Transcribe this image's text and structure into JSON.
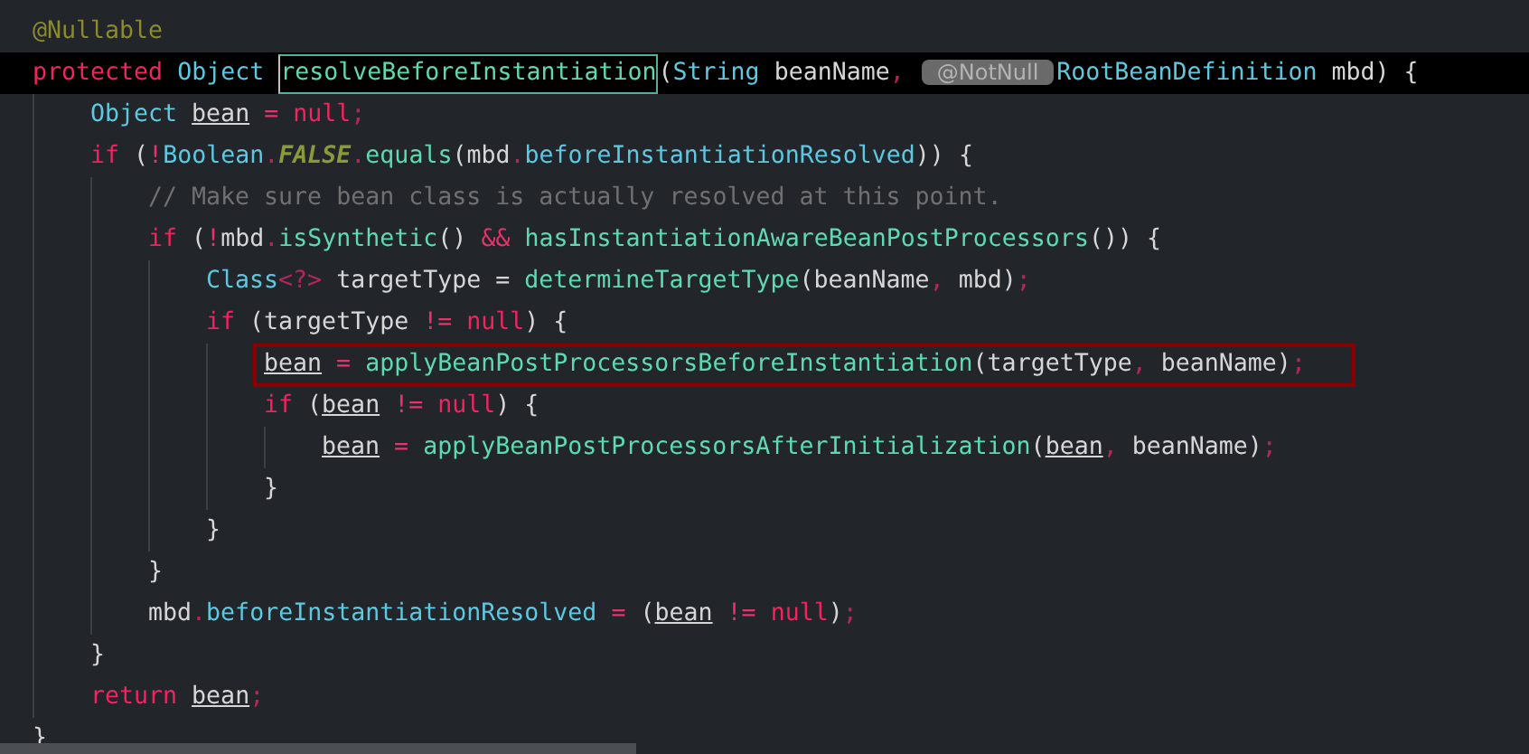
{
  "editor": {
    "lines": [
      {
        "tokens": [
          {
            "text": "@Nullable",
            "kind": "annotation"
          }
        ]
      },
      {
        "current": true,
        "tokens": [
          {
            "text": "protected ",
            "kind": "keyword"
          },
          {
            "text": "Object ",
            "kind": "type"
          },
          {
            "text": "resolveBeforeInstantiation",
            "kind": "method",
            "outlined": true
          },
          {
            "text": "(",
            "kind": "plain"
          },
          {
            "text": "String ",
            "kind": "type"
          },
          {
            "text": "beanName",
            "kind": "plain"
          },
          {
            "text": ",",
            "kind": "punct"
          },
          {
            "text": "@NotNull",
            "kind": "hint"
          },
          {
            "text": "RootBeanDefinition ",
            "kind": "type"
          },
          {
            "text": "mbd) {",
            "kind": "plain"
          }
        ],
        "children": [
          {
            "tokens": [
              {
                "text": "Object ",
                "kind": "type"
              },
              {
                "text": "bean",
                "kind": "variable"
              },
              {
                "text": " = ",
                "kind": "operator"
              },
              {
                "text": "null",
                "kind": "keyword"
              },
              {
                "text": ";",
                "kind": "punct"
              }
            ]
          },
          {
            "tokens": [
              {
                "text": "if ",
                "kind": "keyword"
              },
              {
                "text": "(",
                "kind": "plain"
              },
              {
                "text": "!",
                "kind": "operator"
              },
              {
                "text": "Boolean",
                "kind": "type"
              },
              {
                "text": ".",
                "kind": "punct"
              },
              {
                "text": "FALSE",
                "kind": "constant"
              },
              {
                "text": ".",
                "kind": "punct"
              },
              {
                "text": "equals",
                "kind": "method"
              },
              {
                "text": "(mbd",
                "kind": "plain"
              },
              {
                "text": ".",
                "kind": "punct"
              },
              {
                "text": "beforeInstantiationResolved",
                "kind": "field"
              },
              {
                "text": ")) {",
                "kind": "plain"
              }
            ],
            "children": [
              {
                "tokens": [
                  {
                    "text": "// Make sure bean class is actually resolved at this point.",
                    "kind": "comment"
                  }
                ]
              },
              {
                "tokens": [
                  {
                    "text": "if ",
                    "kind": "keyword"
                  },
                  {
                    "text": "(",
                    "kind": "plain"
                  },
                  {
                    "text": "!",
                    "kind": "operator"
                  },
                  {
                    "text": "mbd",
                    "kind": "plain"
                  },
                  {
                    "text": ".",
                    "kind": "punct"
                  },
                  {
                    "text": "isSynthetic",
                    "kind": "method"
                  },
                  {
                    "text": "() ",
                    "kind": "plain"
                  },
                  {
                    "text": "&& ",
                    "kind": "operator"
                  },
                  {
                    "text": "hasInstantiationAwareBeanPostProcessors",
                    "kind": "method"
                  },
                  {
                    "text": "()) {",
                    "kind": "plain"
                  }
                ],
                "children": [
                  {
                    "tokens": [
                      {
                        "text": "Class",
                        "kind": "type"
                      },
                      {
                        "text": "<?>",
                        "kind": "punct"
                      },
                      {
                        "text": " targetType = ",
                        "kind": "plain"
                      },
                      {
                        "text": "determineTargetType",
                        "kind": "method"
                      },
                      {
                        "text": "(beanName",
                        "kind": "plain"
                      },
                      {
                        "text": ",",
                        "kind": "punct"
                      },
                      {
                        "text": " mbd)",
                        "kind": "plain"
                      },
                      {
                        "text": ";",
                        "kind": "punct"
                      }
                    ]
                  },
                  {
                    "tokens": [
                      {
                        "text": "if ",
                        "kind": "keyword"
                      },
                      {
                        "text": "(targetType ",
                        "kind": "plain"
                      },
                      {
                        "text": "!= ",
                        "kind": "operator"
                      },
                      {
                        "text": "null",
                        "kind": "keyword"
                      },
                      {
                        "text": ") {",
                        "kind": "plain"
                      }
                    ],
                    "children": [
                      {
                        "boxed": true,
                        "tokens": [
                          {
                            "text": "bean",
                            "kind": "variable"
                          },
                          {
                            "text": " = ",
                            "kind": "operator"
                          },
                          {
                            "text": "applyBeanPostProcessorsBeforeInstantiation",
                            "kind": "method"
                          },
                          {
                            "text": "(targetType",
                            "kind": "plain"
                          },
                          {
                            "text": ",",
                            "kind": "punct"
                          },
                          {
                            "text": " beanName)",
                            "kind": "plain"
                          },
                          {
                            "text": ";",
                            "kind": "punct"
                          }
                        ]
                      },
                      {
                        "tokens": [
                          {
                            "text": "if ",
                            "kind": "keyword"
                          },
                          {
                            "text": "(",
                            "kind": "plain"
                          },
                          {
                            "text": "bean",
                            "kind": "variable"
                          },
                          {
                            "text": " != ",
                            "kind": "operator"
                          },
                          {
                            "text": "null",
                            "kind": "keyword"
                          },
                          {
                            "text": ") {",
                            "kind": "plain"
                          }
                        ],
                        "children": [
                          {
                            "tokens": [
                              {
                                "text": "bean",
                                "kind": "variable"
                              },
                              {
                                "text": " = ",
                                "kind": "operator"
                              },
                              {
                                "text": "applyBeanPostProcessorsAfterInitialization",
                                "kind": "method"
                              },
                              {
                                "text": "(",
                                "kind": "plain"
                              },
                              {
                                "text": "bean",
                                "kind": "variable"
                              },
                              {
                                "text": ",",
                                "kind": "punct"
                              },
                              {
                                "text": " beanName)",
                                "kind": "plain"
                              },
                              {
                                "text": ";",
                                "kind": "punct"
                              }
                            ]
                          }
                        ]
                      },
                      {
                        "tokens": [
                          {
                            "text": "}",
                            "kind": "plain"
                          }
                        ]
                      }
                    ]
                  },
                  {
                    "tokens": [
                      {
                        "text": "}",
                        "kind": "plain"
                      }
                    ]
                  }
                ]
              },
              {
                "tokens": [
                  {
                    "text": "}",
                    "kind": "plain"
                  }
                ]
              },
              {
                "tokens": [
                  {
                    "text": "mbd",
                    "kind": "plain"
                  },
                  {
                    "text": ".",
                    "kind": "punct"
                  },
                  {
                    "text": "beforeInstantiationResolved",
                    "kind": "field"
                  },
                  {
                    "text": " = ",
                    "kind": "operator"
                  },
                  {
                    "text": "(",
                    "kind": "plain"
                  },
                  {
                    "text": "bean",
                    "kind": "variable"
                  },
                  {
                    "text": " != ",
                    "kind": "operator"
                  },
                  {
                    "text": "null",
                    "kind": "keyword"
                  },
                  {
                    "text": ")",
                    "kind": "plain"
                  },
                  {
                    "text": ";",
                    "kind": "punct"
                  }
                ]
              }
            ]
          },
          {
            "tokens": [
              {
                "text": "}",
                "kind": "plain"
              }
            ]
          },
          {
            "tokens": [
              {
                "text": "return ",
                "kind": "keyword"
              },
              {
                "text": "bean",
                "kind": "variable"
              },
              {
                "text": ";",
                "kind": "punct"
              }
            ]
          }
        ]
      },
      {
        "tokens": [
          {
            "text": "}",
            "kind": "plain"
          }
        ]
      }
    ]
  }
}
